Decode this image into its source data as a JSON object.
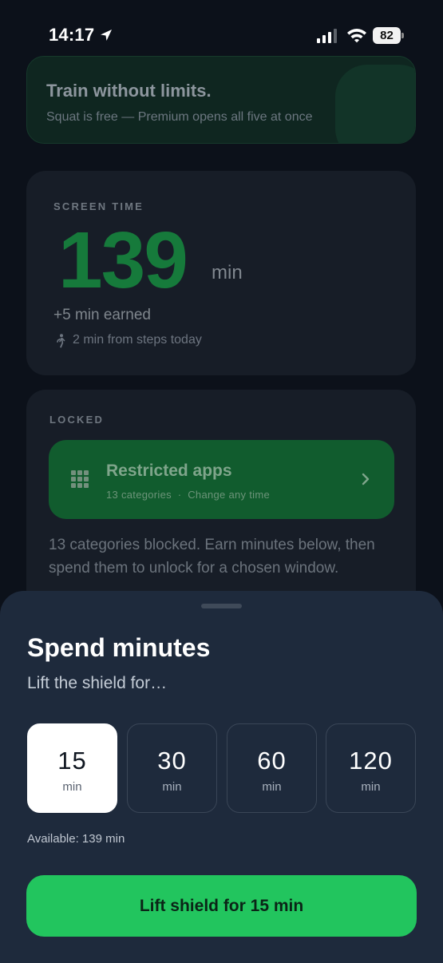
{
  "status_bar": {
    "time": "14:17",
    "battery": "82"
  },
  "promo": {
    "title": "Train without limits.",
    "subtitle": "Squat is free — Premium opens all five at once"
  },
  "screen_time": {
    "label": "SCREEN TIME",
    "value": "139",
    "unit": "min",
    "earned": "+5 min earned",
    "steps": "2 min from steps today"
  },
  "locked": {
    "label": "LOCKED",
    "apps_title": "Restricted apps",
    "apps_subtitle": "13 categories  ·  Change any time",
    "description": "13 categories blocked. Earn minutes below, then spend them to unlock for a chosen window."
  },
  "sheet": {
    "title": "Spend minutes",
    "subtitle": "Lift the shield for…",
    "options": [
      {
        "value": "15",
        "unit": "min",
        "selected": true
      },
      {
        "value": "30",
        "unit": "min",
        "selected": false
      },
      {
        "value": "60",
        "unit": "min",
        "selected": false
      },
      {
        "value": "120",
        "unit": "min",
        "selected": false
      }
    ],
    "available": "Available: 139 min",
    "cta": "Lift shield for 15 min"
  },
  "colors": {
    "accent": "#22c55e",
    "sheet_bg": "#1e2a3c",
    "page_bg": "#0c111a"
  }
}
